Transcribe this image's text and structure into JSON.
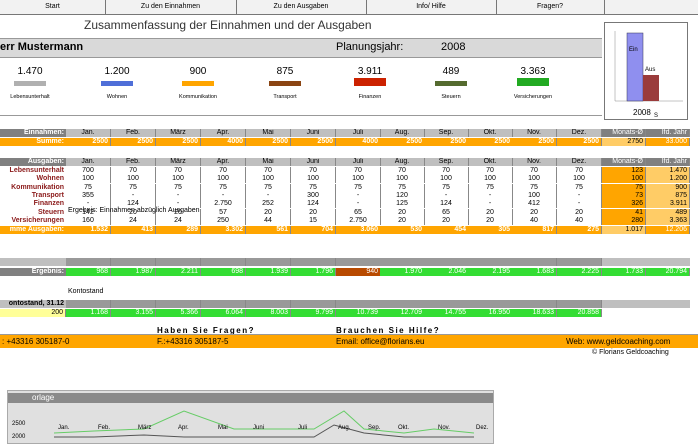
{
  "nav": {
    "buttons": [
      "Start",
      "Zu den Einnahmen",
      "Zu den Ausgaben",
      "Info/ Hilfe",
      "Fragen?"
    ]
  },
  "header": {
    "title": "Zusammenfassung der Einnahmen und der Ausgaben",
    "name": "err Mustermann",
    "planning_label": "Planungsjahr:",
    "planning_year": "2008"
  },
  "summary": {
    "items": [
      {
        "value": "1.470",
        "label": "Lebensunterhalt",
        "color": "#b0b0b0",
        "bar": 0.25
      },
      {
        "value": "1.200",
        "label": "Wohnen",
        "color": "#4f6fd8",
        "bar": 0.25
      },
      {
        "value": "900",
        "label": "Kommunikation",
        "color": "#ffa500",
        "bar": 0.25
      },
      {
        "value": "875",
        "label": "Transport",
        "color": "#8b4513",
        "bar": 0.25
      },
      {
        "value": "3.911",
        "label": "Finanzen",
        "color": "#cc2200",
        "bar": 1.0
      },
      {
        "value": "489",
        "label": "Steuern",
        "color": "#556b2f",
        "bar": 0.25
      },
      {
        "value": "3.363",
        "label": "Versicherungen",
        "color": "#22aa22",
        "bar": 1.0
      }
    ]
  },
  "minichart": {
    "bar1_label": "Ein",
    "bar2_label": "Aus",
    "year": "2008",
    "year_suffix": "S"
  },
  "months": [
    "Jan.",
    "Feb.",
    "März",
    "Apr.",
    "Mai",
    "Juni",
    "Juli",
    "Aug.",
    "Sep.",
    "Okt.",
    "Nov.",
    "Dez."
  ],
  "income": {
    "header": "Einnahmen:",
    "sum_label": "Summe:",
    "avg_header": "Monats-Ø",
    "year_header": "Ifd. Jahr",
    "values": [
      "2500",
      "2500",
      "2500",
      "4000",
      "2500",
      "2500",
      "4000",
      "2500",
      "2500",
      "2500",
      "2500",
      "2500"
    ],
    "avg": "2750",
    "year": "33.000"
  },
  "expenses": {
    "header": "Ausgaben:",
    "avg_header": "Monats-Ø",
    "year_header": "Ifd. Jahr",
    "rows": [
      {
        "label": "Lebensunterhalt",
        "values": [
          "700",
          "70",
          "70",
          "70",
          "70",
          "70",
          "70",
          "70",
          "70",
          "70",
          "70",
          "70"
        ],
        "avg": "123",
        "year": "1.470"
      },
      {
        "label": "Wohnen",
        "values": [
          "100",
          "100",
          "100",
          "100",
          "100",
          "100",
          "100",
          "100",
          "100",
          "100",
          "100",
          "100"
        ],
        "avg": "100",
        "year": "1.200"
      },
      {
        "label": "Kommunikation",
        "values": [
          "75",
          "75",
          "75",
          "75",
          "75",
          "75",
          "75",
          "75",
          "75",
          "75",
          "75",
          "75"
        ],
        "avg": "75",
        "year": "900"
      },
      {
        "label": "Transport",
        "values": [
          "355",
          "-",
          "-",
          "-",
          "-",
          "300",
          "-",
          "120",
          "-",
          "-",
          "100",
          "-"
        ],
        "avg": "73",
        "year": "875"
      },
      {
        "label": "Finanzen",
        "values": [
          "-",
          "124",
          "-",
          "2.750",
          "252",
          "124",
          "-",
          "125",
          "124",
          "-",
          "412",
          "-"
        ],
        "avg": "326",
        "year": "3.911"
      },
      {
        "label": "Steuern",
        "values": [
          "142",
          "20",
          "20",
          "57",
          "20",
          "20",
          "65",
          "20",
          "65",
          "20",
          "20",
          "20"
        ],
        "avg": "41",
        "year": "489"
      },
      {
        "label": "Versicherungen",
        "values": [
          "160",
          "24",
          "24",
          "250",
          "44",
          "15",
          "2.750",
          "20",
          "20",
          "20",
          "40",
          "40"
        ],
        "avg": "280",
        "year": "3.363"
      }
    ],
    "sum_label": "mme Ausgaben:",
    "sums": [
      "1.532",
      "413",
      "289",
      "3.302",
      "561",
      "704",
      "3.060",
      "530",
      "454",
      "305",
      "817",
      "275"
    ],
    "sum_avg": "1.017",
    "sum_year": "12.206"
  },
  "result": {
    "caption": "Ergebnis: Einnahmen abzüglich Ausgaben",
    "label": "Ergebnis:",
    "values": [
      "968",
      "1.987",
      "2.211",
      "698",
      "1.939",
      "1.796",
      "940",
      "1.970",
      "2.046",
      "2.195",
      "1.683",
      "2.225"
    ],
    "avg": "1.733",
    "year": "20.794"
  },
  "balance": {
    "caption": "Kontostand",
    "label": "ontostand, 31.12",
    "start": "200",
    "values": [
      "1.168",
      "3.155",
      "5.366",
      "6.064",
      "8.003",
      "9.799",
      "10.739",
      "12.709",
      "14.755",
      "16.950",
      "18.633",
      "20.858"
    ]
  },
  "footer": {
    "questions": "Haben Sie Fragen?",
    "help": "Brauchen Sie Hilfe?",
    "phone": ": +43316 305187-0",
    "fax": "F.:+43316 305187-5",
    "email": "Email: office@florians.eu",
    "web": "Web: www.geldcoaching.com",
    "copyright": "© Florians Geldcoaching"
  },
  "bottom_chart": {
    "title": "orlage",
    "y_labels": [
      "2500",
      "2000"
    ],
    "month_labels": [
      "Jan.",
      "Feb.",
      "März",
      "Apr.",
      "Mai",
      "Juni",
      "Juli",
      "Aug.",
      "Sep.",
      "Okt.",
      "Nov.",
      "Dez."
    ]
  },
  "colors": {
    "orange": "#ffa500",
    "green": "#33dd33",
    "gray_header": "#808080",
    "dark_red": "#8b1a1a"
  }
}
